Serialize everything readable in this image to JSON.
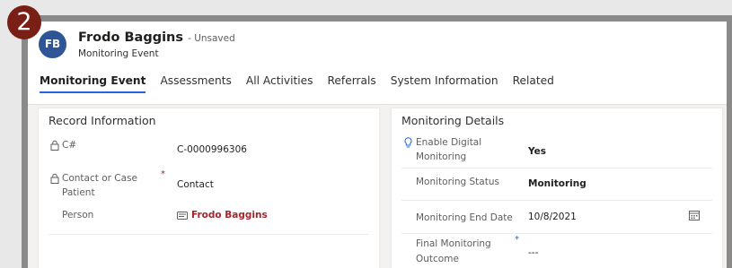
{
  "step_number": "2",
  "record": {
    "avatar_initials": "FB",
    "name": "Frodo Baggins",
    "status": "- Unsaved",
    "entity": "Monitoring Event"
  },
  "tabs": [
    {
      "label": "Monitoring Event",
      "active": true
    },
    {
      "label": "Assessments",
      "active": false
    },
    {
      "label": "All Activities",
      "active": false
    },
    {
      "label": "Referrals",
      "active": false
    },
    {
      "label": "System Information",
      "active": false
    },
    {
      "label": "Related",
      "active": false
    }
  ],
  "record_information": {
    "title": "Record Information",
    "fields": {
      "case_number": {
        "label": "C#",
        "value": "C-0000996306",
        "icon": "lock-icon"
      },
      "contact_or_case": {
        "label_line1": "Contact or Case",
        "label_line2": "Patient",
        "value": "Contact",
        "required": "*",
        "icon": "lock-icon"
      },
      "person": {
        "label": "Person",
        "value": "Frodo Baggins",
        "icon": "contact-card-icon"
      }
    }
  },
  "monitoring_details": {
    "title": "Monitoring Details",
    "fields": {
      "enable_digital": {
        "label_line1": "Enable Digital",
        "label_line2": "Monitoring",
        "value": "Yes",
        "icon": "lightbulb-icon"
      },
      "status": {
        "label": "Monitoring Status",
        "value": "Monitoring"
      },
      "end_date": {
        "label": "Monitoring End Date",
        "value": "10/8/2021",
        "icon": "calendar-icon"
      },
      "final_outcome": {
        "label_line1": "Final Monitoring",
        "label_line2": "Outcome",
        "value": "---",
        "required": "*"
      }
    }
  },
  "colors": {
    "accent": "#2266e3",
    "avatar": "#2f5597",
    "badge": "#7a1f16",
    "link": "#a4262c"
  }
}
